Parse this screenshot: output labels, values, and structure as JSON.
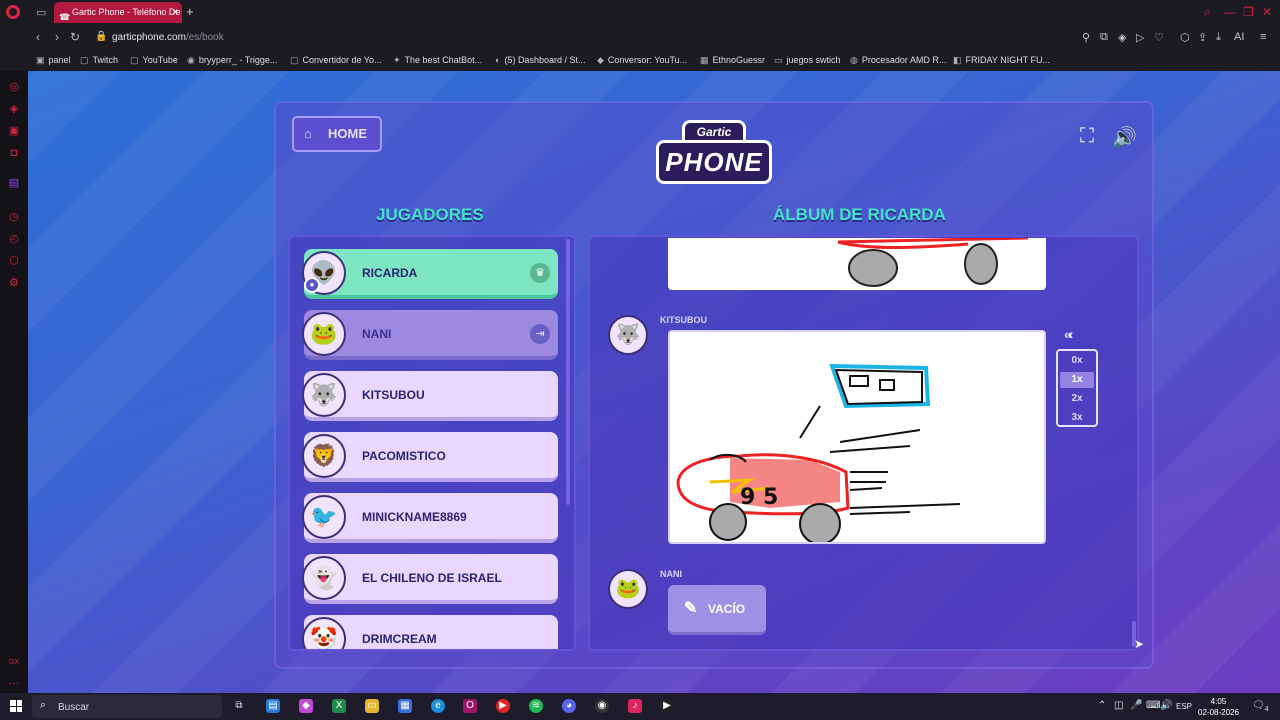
{
  "browser": {
    "tab_title": "Gartic Phone - Teléfono De",
    "url_host": "garticphone.com",
    "url_path": "/es/book",
    "bookmarks": [
      "panel",
      "Twitch",
      "YouTube",
      "bryyperr_ - Trigge...",
      "Convertidor de Yo...",
      "The best ChatBot...",
      "(5) Dashboard / St...",
      "Conversor: YouTu...",
      "EthnoGuessr",
      "juegos swtich",
      "Procesador AMD R...",
      "FRIDAY NIGHT FU..."
    ]
  },
  "game": {
    "home_label": "HOME",
    "logo_top": "Gartic",
    "logo_main": "PHONE",
    "players_title": "JUGADORES",
    "album_title": "ÁLBUM DE RICARDA",
    "players": [
      {
        "name": "RICARDA",
        "state": "host",
        "icon": "crown-icon"
      },
      {
        "name": "NANI",
        "state": "away",
        "icon": "exit-icon"
      },
      {
        "name": "KITSUBOU",
        "state": "normal"
      },
      {
        "name": "PACOMISTICO",
        "state": "normal"
      },
      {
        "name": "MINICKNAME8869",
        "state": "normal"
      },
      {
        "name": "EL CHILENO DE ISRAEL",
        "state": "normal"
      },
      {
        "name": "DRIMCREAM",
        "state": "normal"
      }
    ],
    "entries": [
      {
        "author": "KITSUBOU",
        "type": "drawing"
      },
      {
        "author": "NANI",
        "type": "empty",
        "empty_label": "VACÍO"
      }
    ],
    "speed_options": [
      "0x",
      "1x",
      "2x",
      "3x"
    ],
    "speed_selected": "1x",
    "colors": {
      "accent_teal": "#44e2c7",
      "host_green": "#7ee7c1",
      "panel_purple": "#5a46c6"
    }
  },
  "taskbar": {
    "search_placeholder": "Buscar",
    "lang": "ESP",
    "time": "4:05",
    "date": "02-08-2026",
    "notifications": "4"
  }
}
